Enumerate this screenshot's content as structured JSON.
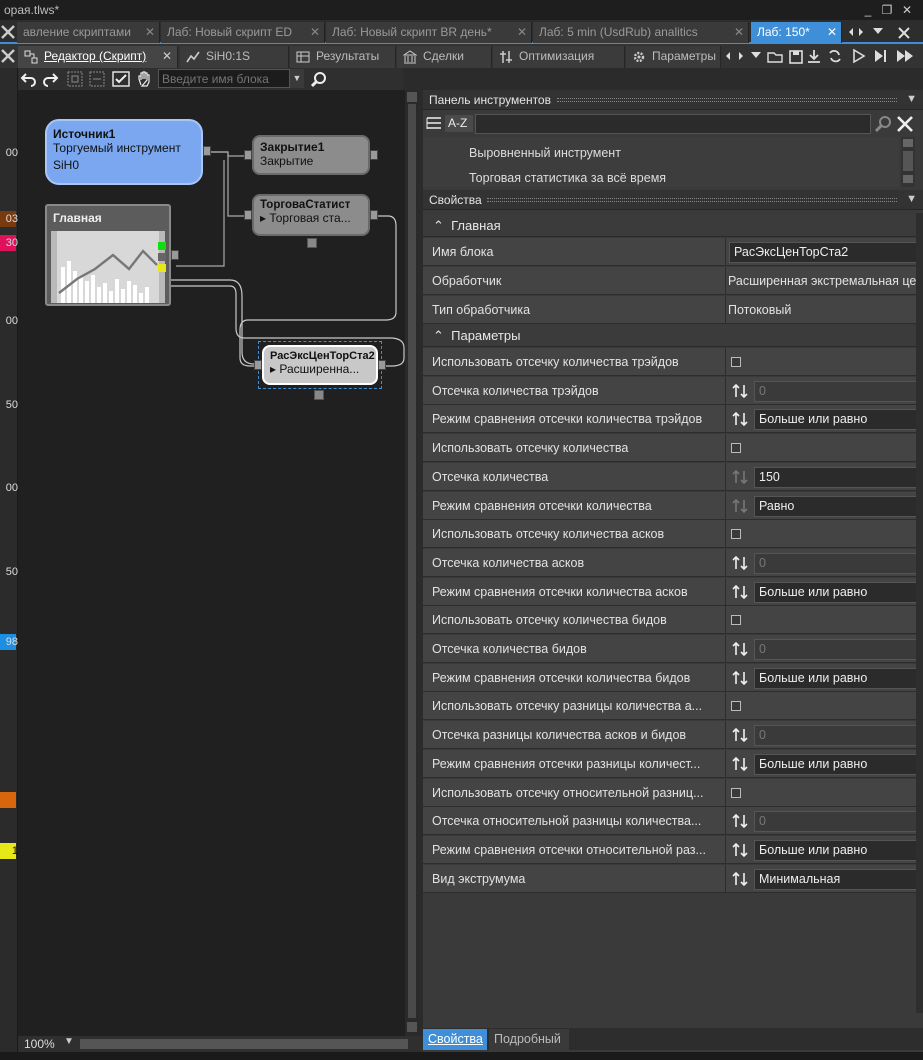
{
  "window": {
    "title": "орая.tlws*",
    "buttons": [
      "_",
      "❐",
      "✕"
    ]
  },
  "doc_tabs": [
    {
      "label": "авление скриптами",
      "active": false
    },
    {
      "label": "Лаб: Новый скрипт ED",
      "active": false
    },
    {
      "label": "Лаб: Новый скрипт  BR день*",
      "active": false
    },
    {
      "label": "Лаб: 5 min (UsdRub) analitics",
      "active": false
    },
    {
      "label": "Лаб: 150*",
      "active": true
    }
  ],
  "tabs": [
    {
      "label": "Редактор (Скрипт)",
      "active": true,
      "icon": "editor-icon",
      "closable": true
    },
    {
      "label": "SiH0:1S",
      "active": false,
      "icon": "chart-icon"
    },
    {
      "label": "Результаты",
      "active": false,
      "icon": "results-icon"
    },
    {
      "label": "Сделки",
      "active": false,
      "icon": "deals-icon"
    },
    {
      "label": "Оптимизация",
      "active": false,
      "icon": "optimization-icon"
    },
    {
      "label": "Параметры",
      "active": false,
      "icon": "gear-icon"
    }
  ],
  "toolbar": {
    "block_placeholder": "Введите имя блока"
  },
  "ruler": {
    "labels": [
      "00",
      "03",
      "30",
      "00",
      "50",
      "00",
      "50",
      "98",
      "1"
    ]
  },
  "nodes": {
    "source": {
      "title": "Источник1",
      "line1": "Торгуемый инструмент",
      "line2": "SiH0"
    },
    "close": {
      "title": "Закрытие1",
      "line1": "Закрытие"
    },
    "stats": {
      "title": "ТорговаСтатист",
      "line1": "Торговая ста..."
    },
    "main": {
      "title": "Главная"
    },
    "ext": {
      "title": "РасЭксЦенТорСта2",
      "line1": "Расширенна..."
    }
  },
  "zoom": {
    "value": "100%"
  },
  "toolbox": {
    "title": "Панель инструментов",
    "sort_label": "A-Z",
    "items": [
      "Выровненный инструмент",
      "Торговая статистика за всё время"
    ]
  },
  "properties": {
    "title": "Свойства",
    "section_main": "Главная",
    "section_params": "Параметры",
    "main_rows": [
      {
        "label": "Имя блока",
        "value": "РасЭксЦенТорСта2",
        "kind": "input"
      },
      {
        "label": "Обработчик",
        "value": "Расширенная экстремальная це",
        "kind": "text"
      },
      {
        "label": "Тип обработчика",
        "value": "Потоковый",
        "kind": "text"
      }
    ],
    "param_rows": [
      {
        "label": "Использовать отсечку количества трэйдов",
        "kind": "check",
        "value": ""
      },
      {
        "label": "Отсечка количества трэйдов",
        "kind": "num",
        "value": "0",
        "disabled": true
      },
      {
        "label": "Режим сравнения отсечки количества трэйдов",
        "kind": "select",
        "value": "Больше или равно"
      },
      {
        "label": "Использовать отсечку количества",
        "kind": "check",
        "value": ""
      },
      {
        "label": "Отсечка количества",
        "kind": "num",
        "value": "150",
        "disabled": false,
        "dim_icon": true
      },
      {
        "label": "Режим сравнения отсечки количества",
        "kind": "select",
        "value": "Равно",
        "dim_icon": true
      },
      {
        "label": "Использовать отсечку количества асков",
        "kind": "check",
        "value": ""
      },
      {
        "label": "Отсечка количества асков",
        "kind": "num",
        "value": "0",
        "disabled": true
      },
      {
        "label": "Режим сравнения отсечки количества асков",
        "kind": "select",
        "value": "Больше или равно"
      },
      {
        "label": "Использовать отсечку количества бидов",
        "kind": "check",
        "value": ""
      },
      {
        "label": "Отсечка количества бидов",
        "kind": "num",
        "value": "0",
        "disabled": true
      },
      {
        "label": "Режим сравнения отсечки количества бидов",
        "kind": "select",
        "value": "Больше или равно"
      },
      {
        "label": "Использовать отсечку разницы количества а...",
        "kind": "check",
        "value": ""
      },
      {
        "label": "Отсечка разницы количества асков и бидов",
        "kind": "num",
        "value": "0",
        "disabled": true
      },
      {
        "label": "Режим сравнения отсечки разницы количест...",
        "kind": "select",
        "value": "Больше или равно"
      },
      {
        "label": "Использовать отсечку относительной разниц...",
        "kind": "check",
        "value": ""
      },
      {
        "label": "Отсечка относительной разницы количества...",
        "kind": "num",
        "value": "0",
        "disabled": true
      },
      {
        "label": "Режим сравнения отсечки относительной раз...",
        "kind": "select",
        "value": "Больше или равно"
      },
      {
        "label": "Вид экструмума",
        "kind": "select",
        "value": "Минимальная"
      }
    ]
  },
  "bottom_tabs": [
    {
      "label": "Свойства",
      "active": true
    },
    {
      "label": "Подробный",
      "active": false
    }
  ],
  "colors": {
    "accent": "#3f8fd8",
    "source_node": "#7aa7f0",
    "ruler_red": "#e0105a",
    "ruler_brown": "#7a3a10",
    "ruler_blue": "#1e8ee0",
    "ruler_orange": "#d8660c",
    "ruler_yellow": "#e8e818"
  }
}
